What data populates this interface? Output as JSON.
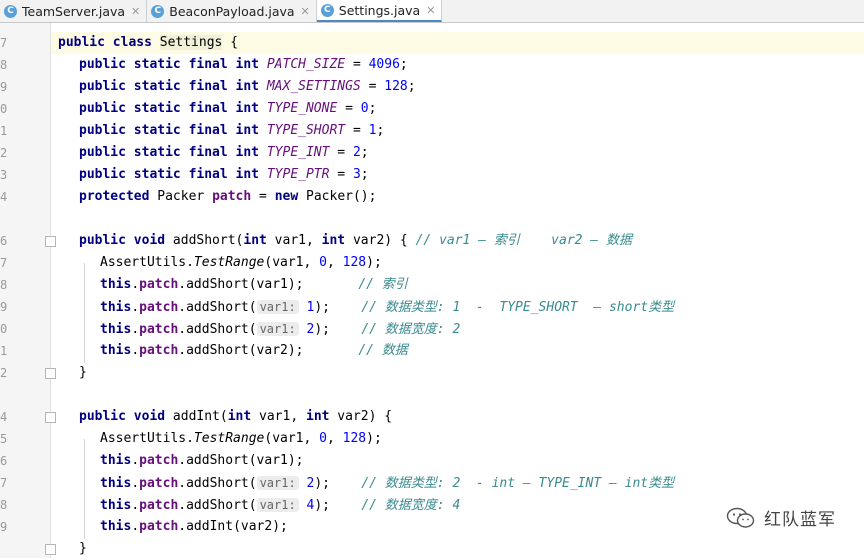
{
  "tabs": [
    {
      "label": "TeamServer.java",
      "active": false
    },
    {
      "label": "BeaconPayload.java",
      "active": false
    },
    {
      "label": "Settings.java",
      "active": true
    }
  ],
  "line_numbers": [
    "7",
    "8",
    "9",
    "0",
    "1",
    "2",
    "3",
    "4",
    "",
    "6",
    "7",
    "8",
    "9",
    "0",
    "1",
    "2",
    "",
    "4",
    "5",
    "6",
    "7",
    "8",
    "9",
    ""
  ],
  "code": {
    "l7": {
      "a": "public class ",
      "b": "Settings",
      " c": " {"
    },
    "patch_size": "PATCH_SIZE",
    "patch_size_val": "4096",
    "max_settings": "MAX_SETTINGS",
    "max_settings_val": "128",
    "type_none": "TYPE_NONE",
    "type_none_val": "0",
    "type_short": "TYPE_SHORT",
    "type_short_val": "1",
    "type_int": "TYPE_INT",
    "type_int_val": "2",
    "type_ptr": "TYPE_PTR",
    "type_ptr_val": "3",
    "psfi": "public static final int ",
    "protected": "protected",
    "packer_decl": " Packer ",
    "patch": "patch",
    "new": "new",
    "packer_ctor": " Packer();",
    "add_short_sig_a": "public void",
    "add_short_sig_b": " addShort(",
    "int": "int",
    "var1": " var1, ",
    "var2": " var2) { ",
    "comment_addshort": "// var1 — 索引    var2 — 数据",
    "assert_a": "AssertUtils.",
    "assert_b": "TestRange",
    "assert_c": "(var1, ",
    "assert_0": "0",
    "assert_128": "128",
    "assert_end": ");",
    "this": "this",
    "call_addshort_var1": ".addShort(var1);",
    "comment_index": "// 索引",
    "call_addshort_open": ".addShort(",
    "hint_var1": "var1:",
    "val_1": "1",
    "close_paren": ");",
    "comment_type_short": "// 数据类型: 1  -  TYPE_SHORT  — short类型",
    "val_2": "2",
    "comment_width2": "// 数据宽度: 2",
    "call_addshort_var2": ".addShort(var2);",
    "comment_data": "// 数据",
    "brace_close": "}",
    "add_int_sig_b": " addInt(",
    "var2_int": " var2) {",
    "comment_type_int": "// 数据类型: 2  - int — TYPE_INT — int类型",
    "val_4": "4",
    "comment_width4": "// 数据宽度: 4",
    "call_addint_var2": ".addInt(var2);"
  },
  "watermark": "红队蓝军"
}
